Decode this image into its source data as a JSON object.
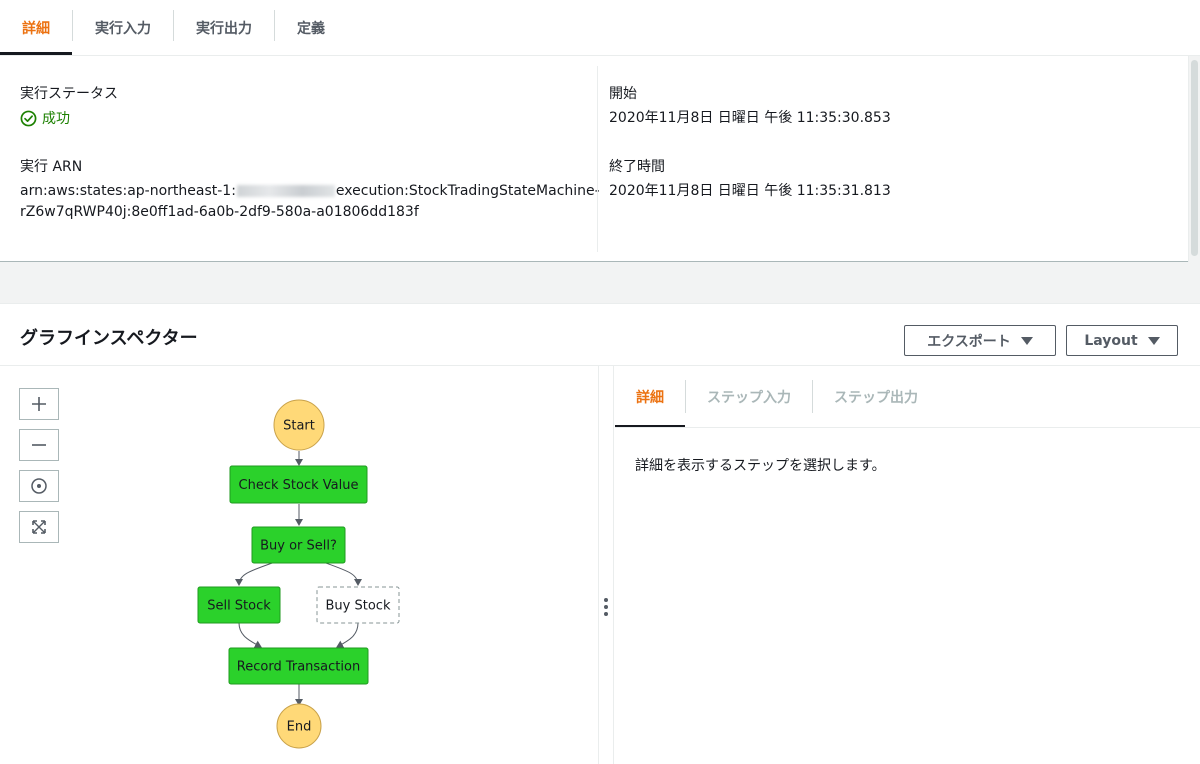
{
  "tabs": [
    {
      "label": "詳細",
      "active": true
    },
    {
      "label": "実行入力",
      "active": false
    },
    {
      "label": "実行出力",
      "active": false
    },
    {
      "label": "定義",
      "active": false
    }
  ],
  "details": {
    "status_label": "実行ステータス",
    "status_value": "成功",
    "arn_label": "実行 ARN",
    "arn_prefix": "arn:aws:states:ap-northeast-1:",
    "arn_suffix": "execution:StockTradingStateMachine-",
    "arn_line2": "rZ6w7qRWP40j:8e0ff1ad-6a0b-2df9-580a-a01806dd183f",
    "start_label": "開始",
    "start_value": "2020年11月8日 日曜日 午後 11:35:30.853",
    "end_label": "終了時間",
    "end_value": "2020年11月8日 日曜日 午後 11:35:31.813"
  },
  "graph_inspector": {
    "title": "グラフインスペクター",
    "export_label": "エクスポート",
    "layout_label": "Layout",
    "nodes": {
      "start": "Start",
      "check": "Check Stock Value",
      "choice": "Buy or Sell?",
      "sell": "Sell Stock",
      "buy": "Buy Stock",
      "record": "Record Transaction",
      "end": "End"
    },
    "side_tabs": [
      {
        "label": "詳細",
        "active": true
      },
      {
        "label": "ステップ入力",
        "active": false
      },
      {
        "label": "ステップ出力",
        "active": false
      }
    ],
    "side_message": "詳細を表示するステップを選択します。"
  },
  "colors": {
    "accent": "#ec7211",
    "success": "#1d8102",
    "node_success": "#2bd12b",
    "node_terminal": "#ffd978"
  }
}
